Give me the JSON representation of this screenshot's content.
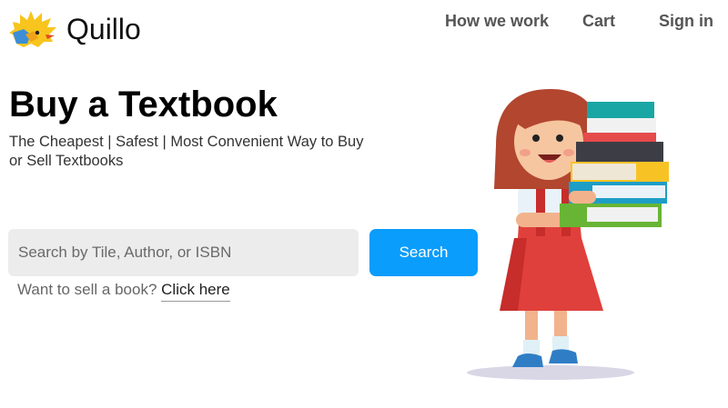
{
  "brand": {
    "name": "Quillo",
    "logo_icon": "porcupine-logo-icon"
  },
  "nav": {
    "how_we_work": "How we work",
    "cart": "Cart",
    "sign_in": "Sign in"
  },
  "hero": {
    "title": "Buy a Textbook",
    "subtitle": "The Cheapest | Safest | Most Convenient Way to Buy or Sell Textbooks"
  },
  "search": {
    "placeholder": "Search by Tile, Author, or ISBN",
    "button_label": "Search"
  },
  "sell": {
    "prompt": "Want to sell a book?",
    "link_label": "Click here"
  },
  "illustration": {
    "icon": "girl-carrying-books-illustration"
  },
  "colors": {
    "accent": "#0b9dfb",
    "input_bg": "#ececec",
    "nav_text": "#555555"
  }
}
